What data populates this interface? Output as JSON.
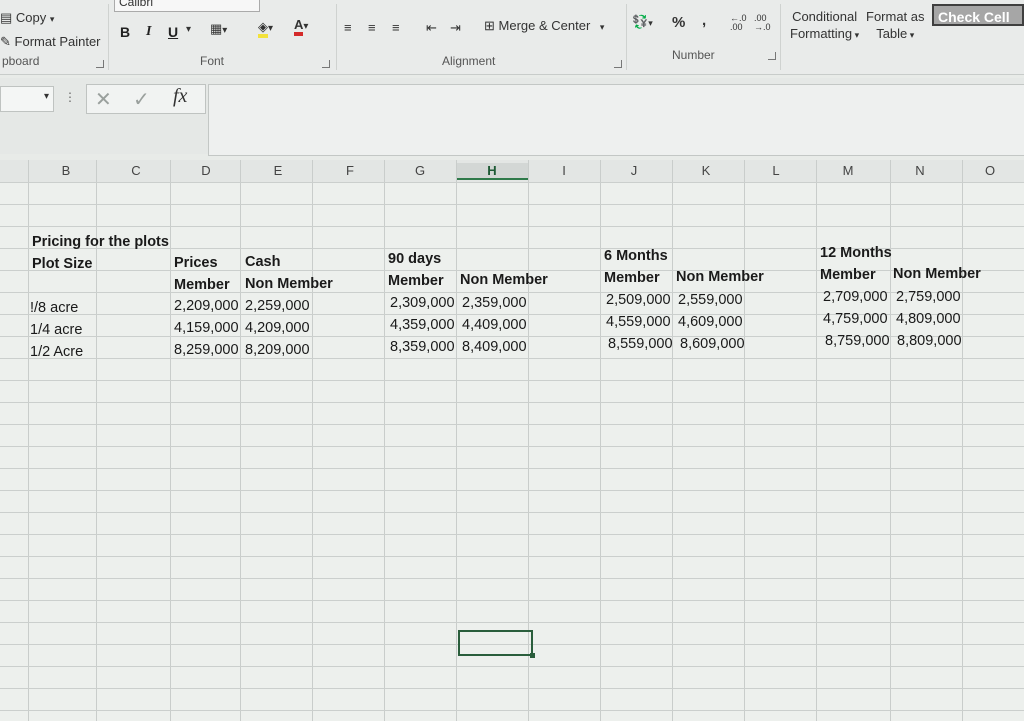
{
  "ribbon": {
    "font_name": "Calibri",
    "copy": "Copy",
    "format_painter": "Format Painter",
    "clipboard_group": "pboard",
    "font_group": "Font",
    "alignment_group": "Alignment",
    "number_group": "Number",
    "bold": "B",
    "italic": "I",
    "underline": "U",
    "merge_center": "Merge & Center",
    "percent": "%",
    "comma": ",",
    "conditional_formatting_l1": "Conditional",
    "conditional_formatting_l2": "Formatting",
    "format_as_table_l1": "Format as",
    "format_as_table_l2": "Table",
    "check_cell": "Check Cell"
  },
  "formula_bar": {
    "fx": "fx",
    "value": ""
  },
  "columns": [
    "B",
    "C",
    "D",
    "E",
    "F",
    "G",
    "H",
    "I",
    "J",
    "K",
    "L",
    "M",
    "N",
    "O"
  ],
  "selected_column": "H",
  "sheet": {
    "title": "Pricing for the plots",
    "plot_size_header": "Plot Size",
    "group_cash": "Prices",
    "cash_label": "Cash",
    "group_90": "90 days",
    "group_6m": "6 Months",
    "group_12m": "12 Months",
    "member": "Member",
    "non_member": "Non Member",
    "rows": [
      {
        "size": "!/8 acre",
        "cash_m": "2,209,000",
        "cash_nm": "2,259,000",
        "d90_m": "2,309,000",
        "d90_nm": "2,359,000",
        "m6_m": "2,509,000",
        "m6_nm": "2,559,000",
        "m12_m": "2,709,000",
        "m12_nm": "2,759,000"
      },
      {
        "size": "1/4 acre",
        "cash_m": "4,159,000",
        "cash_nm": "4,209,000",
        "d90_m": "4,359,000",
        "d90_nm": "4,409,000",
        "m6_m": "4,559,000",
        "m6_nm": "4,609,000",
        "m12_m": "4,759,000",
        "m12_nm": "4,809,000"
      },
      {
        "size": "1/2 Acre",
        "cash_m": "8,259,000",
        "cash_nm": "8,209,000",
        "d90_m": "8,359,000",
        "d90_nm": "8,409,000",
        "m6_m": "8,559,000",
        "m6_nm": "8,609,000",
        "m12_m": "8,759,000",
        "m12_nm": "8,809,000"
      }
    ]
  }
}
